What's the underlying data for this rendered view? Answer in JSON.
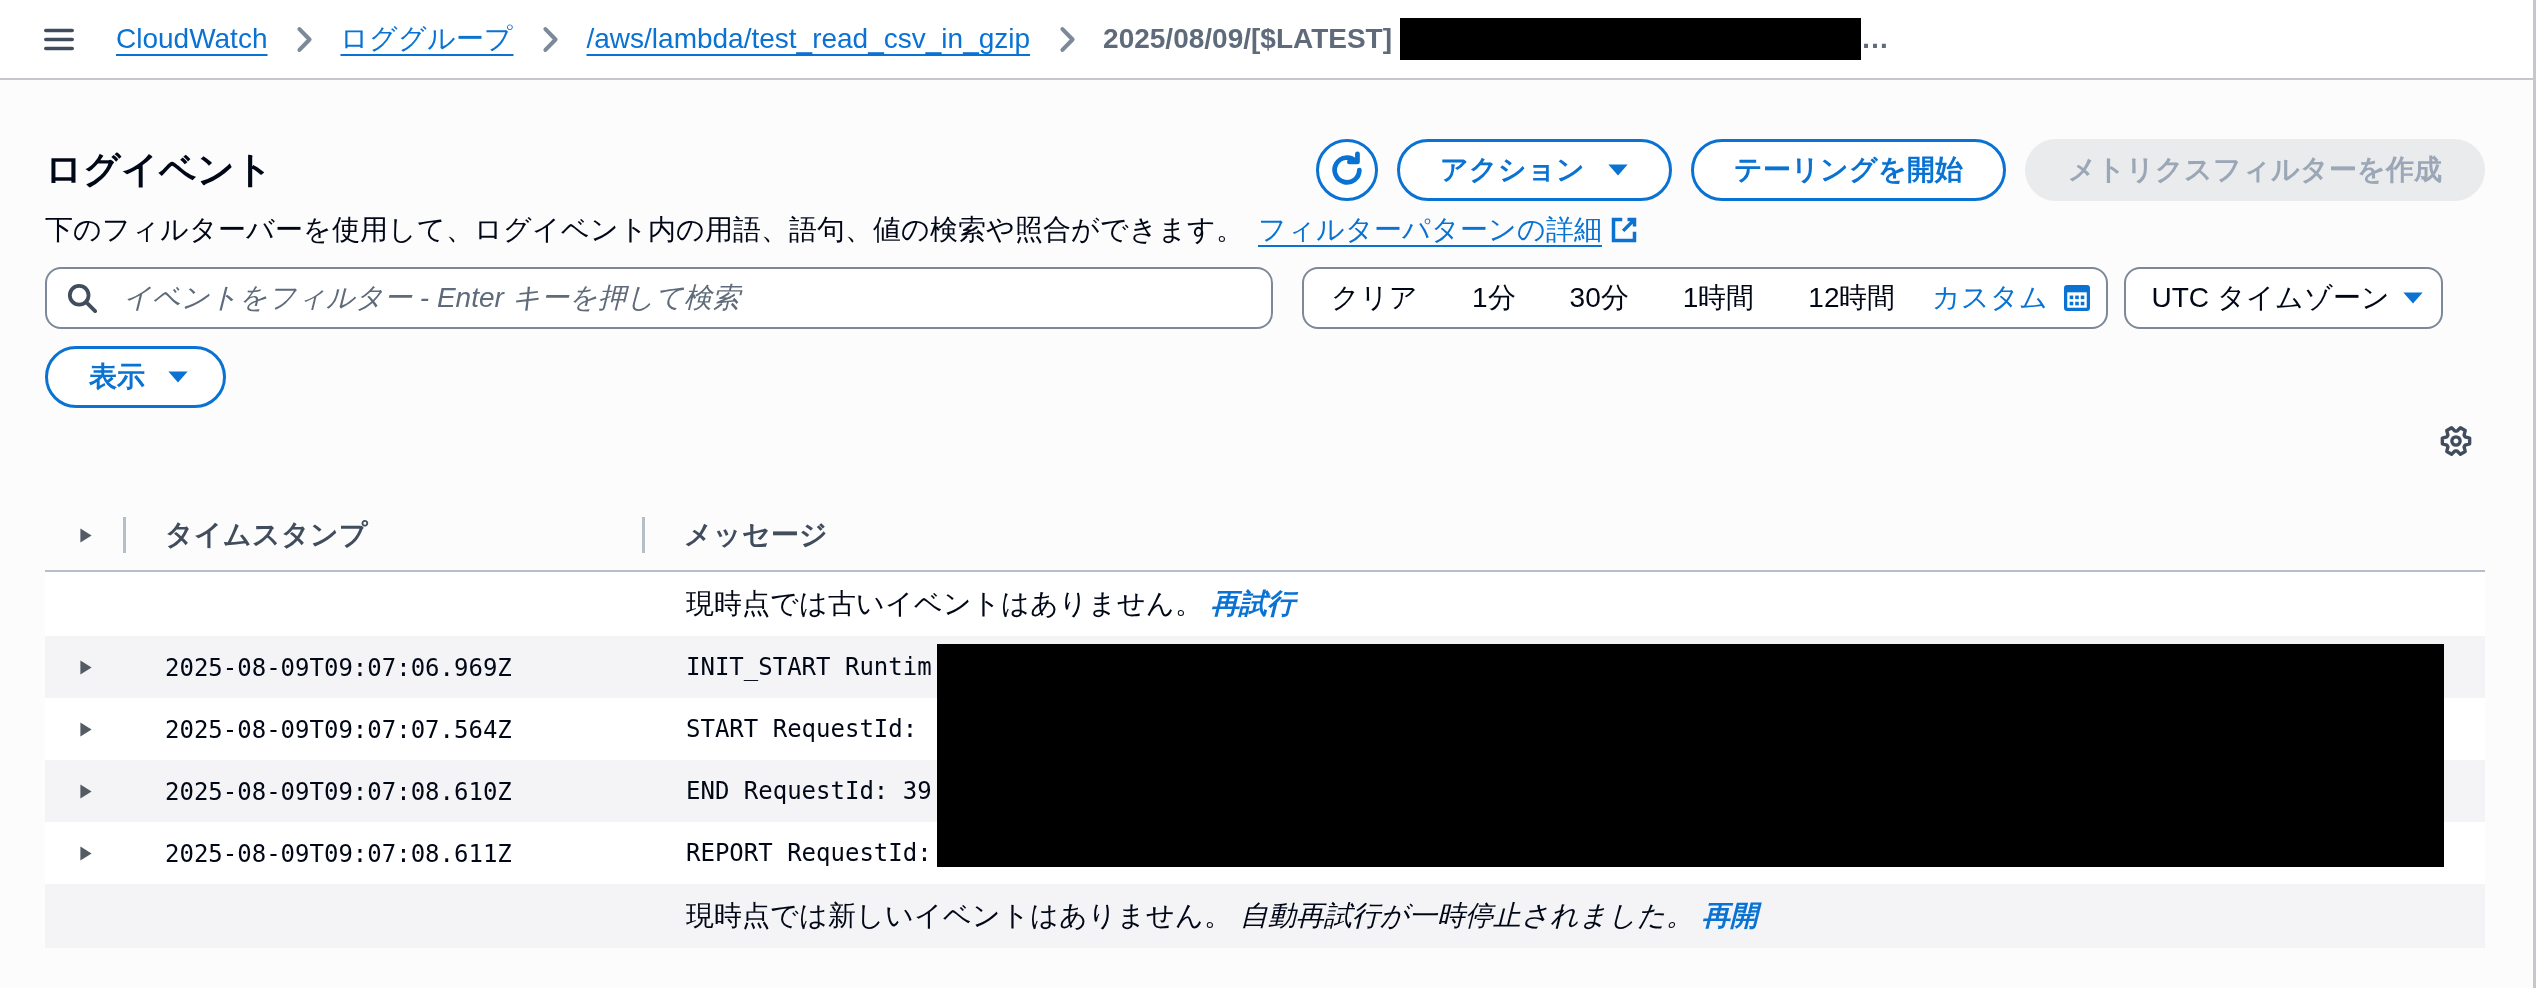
{
  "breadcrumbs": [
    {
      "label": "CloudWatch",
      "kind": "link",
      "redacted": false
    },
    {
      "label": "ロググループ",
      "kind": "link",
      "redacted": false
    },
    {
      "label": "/aws/lambda/test_read_csv_in_gzip",
      "kind": "link",
      "redacted": false
    },
    {
      "label": "2025/08/09/[$LATEST]",
      "kind": "current",
      "redacted": true,
      "tail": "…"
    }
  ],
  "page": {
    "title": "ログイベント",
    "description": "下のフィルターバーを使用して、ログイベント内の用語、語句、値の検索や照合ができます。",
    "help_link": "フィルターパターンの詳細"
  },
  "actions": [
    {
      "kind": "refresh",
      "disabled": false
    },
    {
      "kind": "dropdown",
      "label": "アクション",
      "disabled": false
    },
    {
      "kind": "button",
      "label": "テーリングを開始",
      "disabled": false
    },
    {
      "kind": "button",
      "label": "メトリクスフィルターを作成",
      "disabled": true
    }
  ],
  "filter": {
    "placeholder": "イベントをフィルター - Enter キーを押して検索"
  },
  "time_range": [
    {
      "kind": "clear",
      "label": "クリア",
      "selected": false
    },
    {
      "kind": "relative",
      "label": "1分",
      "selected": false
    },
    {
      "kind": "relative",
      "label": "30分",
      "selected": false
    },
    {
      "kind": "relative",
      "label": "1時間",
      "selected": false
    },
    {
      "kind": "relative",
      "label": "12時間",
      "selected": false
    },
    {
      "kind": "custom",
      "label": "カスタム",
      "selected": false
    }
  ],
  "timezone": {
    "value": "UTC タイムゾーン"
  },
  "view_button": {
    "label": "表示"
  },
  "log_table": {
    "expanded": false,
    "columns": [
      {
        "label": "タイムスタンプ"
      },
      {
        "label": "メッセージ"
      }
    ],
    "rows": [
      {
        "kind": "notice",
        "message": "現時点では古いイベントはありません。",
        "link": "再試行"
      },
      {
        "kind": "event",
        "expanded": false,
        "timestamp": "2025-08-09T09:07:06.969Z",
        "message": "INIT_START Runtim",
        "redacted": true
      },
      {
        "kind": "event",
        "expanded": false,
        "timestamp": "2025-08-09T09:07:07.564Z",
        "message": "START RequestId:",
        "redacted": true
      },
      {
        "kind": "event",
        "expanded": false,
        "timestamp": "2025-08-09T09:07:08.610Z",
        "message": "END RequestId: 39",
        "redacted": true
      },
      {
        "kind": "event",
        "expanded": false,
        "timestamp": "2025-08-09T09:07:08.611Z",
        "message": "REPORT RequestId:",
        "redacted": true
      },
      {
        "kind": "notice",
        "message": "現時点では新しいイベントはありません。",
        "note": "自動再試行が一時停止されました。",
        "link": "再開"
      }
    ]
  }
}
